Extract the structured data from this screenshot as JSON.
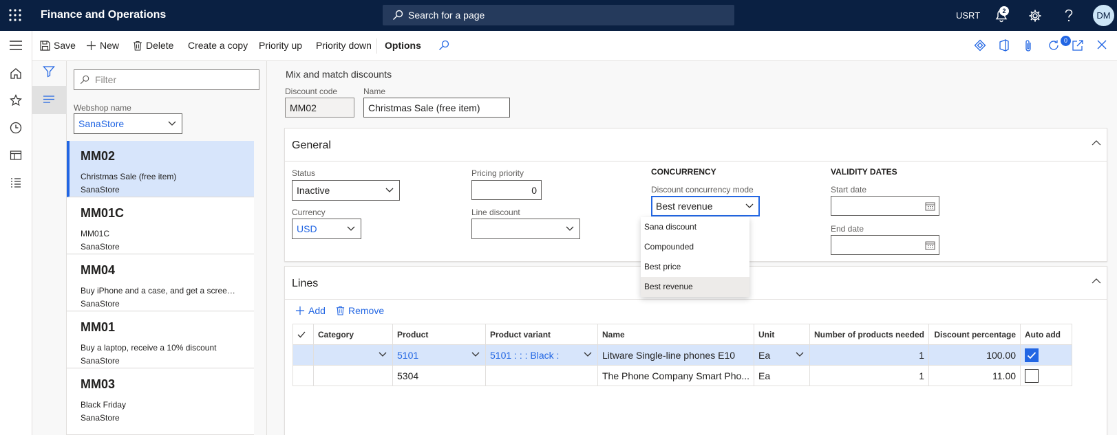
{
  "topbar": {
    "app_title": "Finance and Operations",
    "search_placeholder": "Search for a page",
    "company": "USRT",
    "notification_count": "2",
    "avatar_initials": "DM"
  },
  "actions": {
    "save": "Save",
    "new": "New",
    "delete": "Delete",
    "create_copy": "Create a copy",
    "priority_up": "Priority up",
    "priority_down": "Priority down",
    "options": "Options",
    "attachments_count": "0"
  },
  "list": {
    "filter_placeholder": "Filter",
    "webshop_label": "Webshop name",
    "webshop_value": "SanaStore",
    "records": [
      {
        "code": "MM02",
        "desc": "Christmas Sale (free item)",
        "webshop": "SanaStore"
      },
      {
        "code": "MM01C",
        "desc": "MM01C",
        "webshop": "SanaStore"
      },
      {
        "code": "MM04",
        "desc": "Buy iPhone and a case, and get a screen ...",
        "webshop": "SanaStore"
      },
      {
        "code": "MM01",
        "desc": "Buy a laptop, receive a 10% discount",
        "webshop": "SanaStore"
      },
      {
        "code": "MM03",
        "desc": "Black Friday",
        "webshop": "SanaStore"
      }
    ]
  },
  "detail": {
    "page_title": "Mix and match discounts",
    "discount_code_label": "Discount code",
    "discount_code": "MM02",
    "name_label": "Name",
    "name": "Christmas Sale (free item)",
    "general": {
      "title": "General",
      "status_label": "Status",
      "status": "Inactive",
      "currency_label": "Currency",
      "currency": "USD",
      "pricing_priority_label": "Pricing priority",
      "pricing_priority": "0",
      "line_discount_label": "Line discount",
      "line_discount": "",
      "concurrency_heading": "CONCURRENCY",
      "concurrency_mode_label": "Discount concurrency mode",
      "concurrency_mode": "Best revenue",
      "concurrency_options": [
        "Sana discount",
        "Compounded",
        "Best price",
        "Best revenue"
      ],
      "validity_heading": "VALIDITY DATES",
      "start_date_label": "Start date",
      "start_date": "",
      "end_date_label": "End date",
      "end_date": ""
    },
    "lines": {
      "title": "Lines",
      "add": "Add",
      "remove": "Remove",
      "columns": [
        "Category",
        "Product",
        "Product variant",
        "Name",
        "Unit",
        "Number of products needed",
        "Discount percentage",
        "Auto add"
      ],
      "rows": [
        {
          "category": "",
          "product": "5101",
          "variant": "5101 : : : Black :",
          "name": "Litware Single-line phones E10",
          "unit": "Ea",
          "qty": "1",
          "pct": "100.00",
          "auto_add": true
        },
        {
          "category": "",
          "product": "5304",
          "variant": "",
          "name": "The Phone Company Smart Pho...",
          "unit": "Ea",
          "qty": "1",
          "pct": "11.00",
          "auto_add": false
        }
      ]
    }
  }
}
